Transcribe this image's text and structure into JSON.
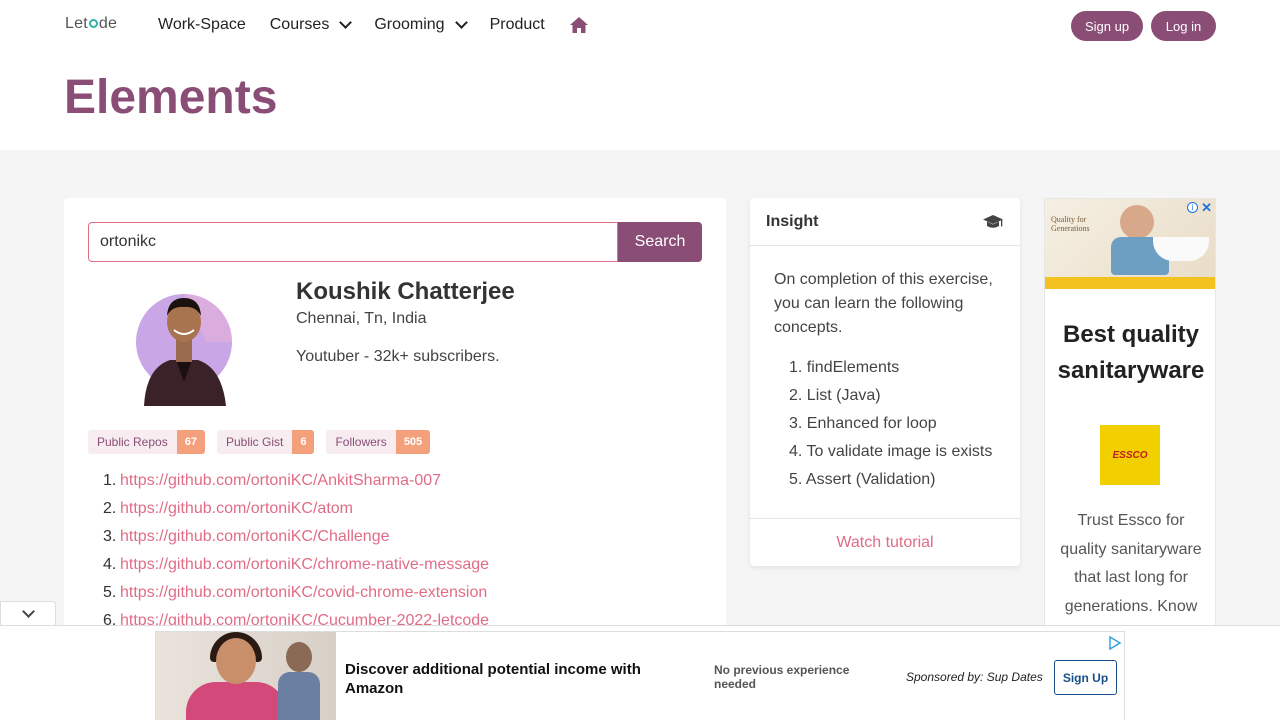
{
  "header": {
    "logo": {
      "pre": "Let",
      "post": "de"
    },
    "nav": [
      {
        "label": "Work-Space",
        "dropdown": false
      },
      {
        "label": "Courses",
        "dropdown": true
      },
      {
        "label": "Grooming",
        "dropdown": true
      },
      {
        "label": "Product",
        "dropdown": false
      }
    ],
    "home_icon": "home-icon",
    "signup_label": "Sign up",
    "login_label": "Log in"
  },
  "page": {
    "title": "Elements"
  },
  "search": {
    "value": "ortonikc",
    "button_label": "Search"
  },
  "profile": {
    "name": "Koushik Chatterjee",
    "location": "Chennai, Tn, India",
    "bio": "Youtuber - 32k+ subscribers.",
    "stats": [
      {
        "label": "Public Repos",
        "count": "67"
      },
      {
        "label": "Public Gist",
        "count": "6"
      },
      {
        "label": "Followers",
        "count": "505"
      }
    ],
    "repos": [
      {
        "num": "1.",
        "url": "https://github.com/ortoniKC/AnkitSharma-007"
      },
      {
        "num": "2.",
        "url": "https://github.com/ortoniKC/atom"
      },
      {
        "num": "3.",
        "url": "https://github.com/ortoniKC/Challenge"
      },
      {
        "num": "4.",
        "url": "https://github.com/ortoniKC/chrome-native-message"
      },
      {
        "num": "5.",
        "url": "https://github.com/ortoniKC/covid-chrome-extension"
      },
      {
        "num": "6.",
        "url": "https://github.com/ortoniKC/Cucumber-2022-letcode"
      }
    ]
  },
  "insight": {
    "title": "Insight",
    "icon": "graduation-cap-icon",
    "intro": "On completion of this exercise, you can learn the following concepts.",
    "concepts": [
      {
        "num": "1.",
        "text": "findElements"
      },
      {
        "num": "2.",
        "text": "List (Java)"
      },
      {
        "num": "3.",
        "text": "Enhanced for loop"
      },
      {
        "num": "4.",
        "text": "To validate image is exists"
      },
      {
        "num": "5.",
        "text": "Assert (Validation)"
      }
    ],
    "footer_link": "Watch tutorial"
  },
  "side_ad": {
    "headline": "Best quality sanitaryware",
    "brand": "ESSCO",
    "description": "Trust Essco for quality sanitaryware that last long for generations. Know",
    "image_text": "Quality for Generations"
  },
  "bottom_ad": {
    "headline": "Discover additional potential income with Amazon",
    "subtext": "No previous experience needed",
    "sponsor": "Sponsored by: Sup Dates",
    "button_label": "Sign Up"
  },
  "colors": {
    "brand": "#8a4d76",
    "link": "#e06d86",
    "badge": "#f4a07c"
  }
}
